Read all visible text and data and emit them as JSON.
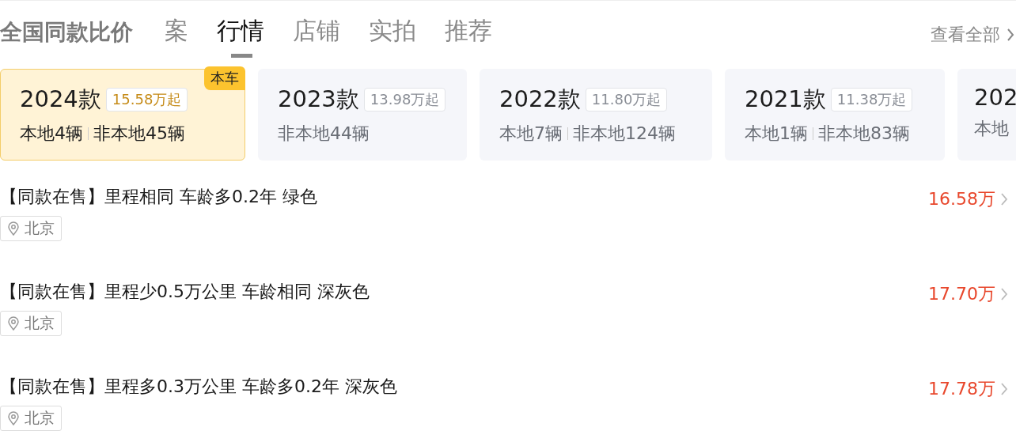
{
  "tabs": [
    {
      "label": "案",
      "selected": false
    },
    {
      "label": "行情",
      "selected": true
    },
    {
      "label": "店铺",
      "selected": false
    },
    {
      "label": "实拍",
      "selected": false
    },
    {
      "label": "推荐",
      "selected": false
    }
  ],
  "heading": "全国同款比价",
  "view_all": "查看全部",
  "year_cards": [
    {
      "year": "2024款",
      "price": "15.58万起",
      "badge": "本车",
      "selected": true,
      "counts": [
        "本地4辆",
        "非本地45辆"
      ]
    },
    {
      "year": "2023款",
      "price": "13.98万起",
      "selected": false,
      "counts": [
        "非本地44辆"
      ]
    },
    {
      "year": "2022款",
      "price": "11.80万起",
      "selected": false,
      "counts": [
        "本地7辆",
        "非本地124辆"
      ]
    },
    {
      "year": "2021款",
      "price": "11.38万起",
      "selected": false,
      "counts": [
        "本地1辆",
        "非本地83辆"
      ]
    },
    {
      "year": "202",
      "selected": false,
      "counts": [
        "本地"
      ]
    }
  ],
  "listings": [
    {
      "title": "【同款在售】里程相同 车龄多0.2年 绿色",
      "location": "北京",
      "price": "16.58万"
    },
    {
      "title": "【同款在售】里程少0.5万公里 车龄相同 深灰色",
      "location": "北京",
      "price": "17.70万"
    },
    {
      "title": "【同款在售】里程多0.3万公里 车龄多0.2年 深灰色",
      "location": "北京",
      "price": "17.78万"
    }
  ]
}
